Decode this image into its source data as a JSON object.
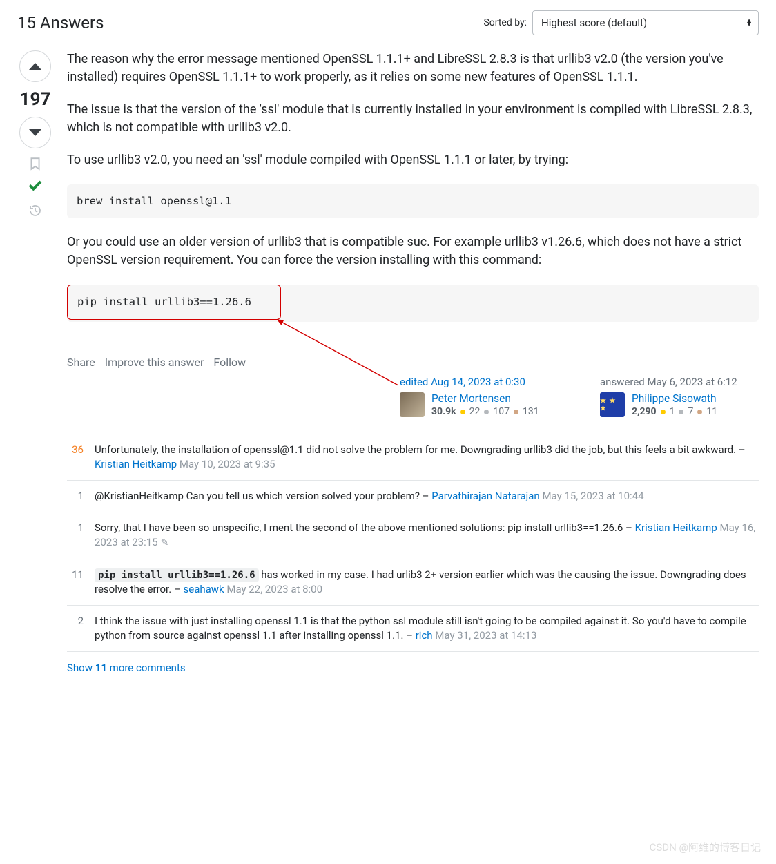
{
  "header": {
    "title": "15 Answers",
    "sort_label": "Sorted by:",
    "sort_value": "Highest score (default)"
  },
  "vote": {
    "score": "197"
  },
  "answer": {
    "p1": "The reason why the error message mentioned OpenSSL 1.1.1+ and LibreSSL 2.8.3 is that urllib3 v2.0 (the version you've installed) requires OpenSSL 1.1.1+ to work properly, as it relies on some new features of OpenSSL 1.1.1.",
    "p2": "The issue is that the version of the 'ssl' module that is currently installed in your environment is compiled with LibreSSL 2.8.3, which is not compatible with urllib3 v2.0.",
    "p3": "To use urllib3 v2.0, you need an 'ssl' module compiled with OpenSSL 1.1.1 or later, by trying:",
    "code1": "brew install openssl@1.1",
    "p4": "Or you could use an older version of urllib3 that is compatible suc. For example urllib3 v1.26.6, which does not have a strict OpenSSL version requirement. You can force the version installing with this command:",
    "code2": "pip install urllib3==1.26.6"
  },
  "menu": {
    "share": "Share",
    "improve": "Improve this answer",
    "follow": "Follow"
  },
  "editor": {
    "line": "edited Aug 14, 2023 at 0:30",
    "name": "Peter Mortensen",
    "rep": "30.9k",
    "gold": "22",
    "silver": "107",
    "bronze": "131"
  },
  "author": {
    "line": "answered May 6, 2023 at 6:12",
    "name": "Philippe Sisowath",
    "rep": "2,290",
    "gold": "1",
    "silver": "7",
    "bronze": "11"
  },
  "comments": [
    {
      "score": "36",
      "hot": true,
      "text": "Unfortunately, the installation of openssl@1.1 did not solve the problem for me. Downgrading urllib3 did the job, but this feels a bit awkward.",
      "author": "Kristian Heitkamp",
      "time": "May 10, 2023 at 9:35"
    },
    {
      "score": "1",
      "text": "@KristianHeitkamp Can you tell us which version solved your problem?",
      "author": "Parvathirajan Natarajan",
      "time": "May 15, 2023 at 10:44"
    },
    {
      "score": "1",
      "text": "Sorry, that I have been so unspecific, I ment the second of the above mentioned solutions: pip install urllib3==1.26.6",
      "author": "Kristian Heitkamp",
      "time": "May 16, 2023 at 23:15",
      "edited": true
    },
    {
      "score": "11",
      "code": "pip install urllib3==1.26.6",
      "text_after": " has worked in my case. I had urlib3 2+ version earlier which was the causing the issue. Downgrading does resolve the error.",
      "author": "seahawk",
      "time": "May 22, 2023 at 8:00"
    },
    {
      "score": "2",
      "text": "I think the issue with just installing openssl 1.1 is that the python ssl module still isn't going to be compiled against it. So you'd have to compile python from source against openssl 1.1 after installing openssl 1.1.",
      "author": "rich",
      "time": "May 31, 2023 at 14:13"
    }
  ],
  "show_more_prefix": "Show ",
  "show_more_count": "11",
  "show_more_suffix": " more comments",
  "watermark": "CSDN @阿维的博客日记"
}
